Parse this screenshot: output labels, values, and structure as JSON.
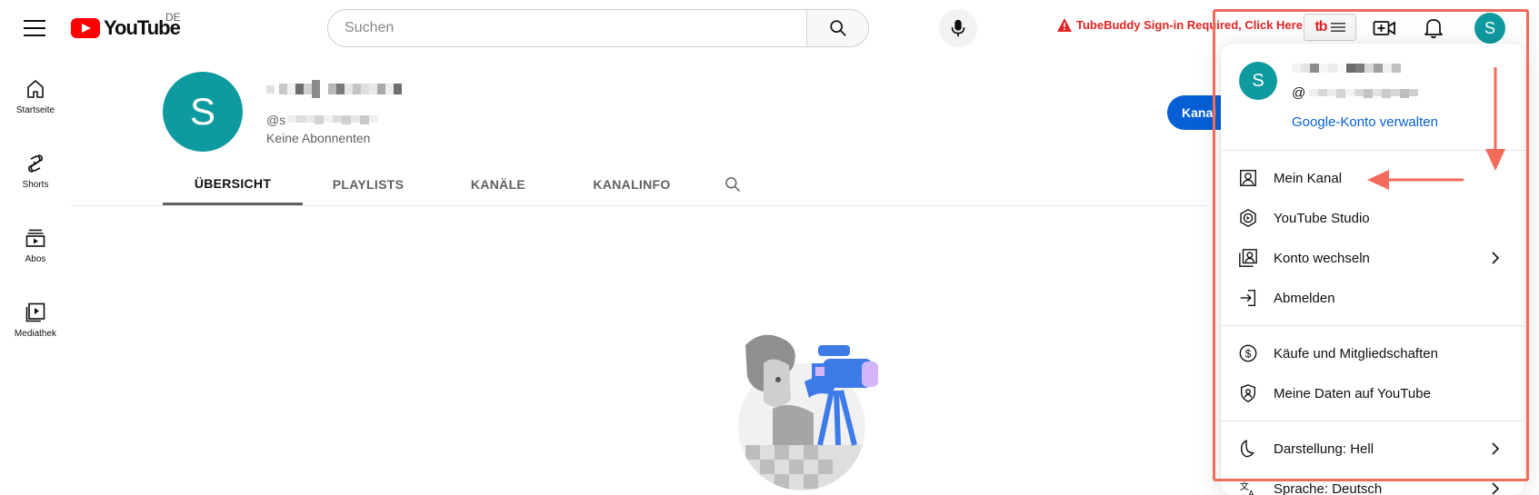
{
  "header": {
    "logo_text": "YouTube",
    "country": "DE",
    "search_placeholder": "Suchen",
    "tubebuddy_warning": "TubeBuddy Sign-in Required, Click Here",
    "tubebuddy_logo": "tb",
    "avatar_letter": "S"
  },
  "sidebar": {
    "items": [
      {
        "label": "Startseite",
        "icon": "home-icon"
      },
      {
        "label": "Shorts",
        "icon": "shorts-icon"
      },
      {
        "label": "Abos",
        "icon": "subscriptions-icon"
      },
      {
        "label": "Mediathek",
        "icon": "library-icon"
      }
    ]
  },
  "channel": {
    "avatar_letter": "S",
    "handle_prefix": "@s",
    "subscribers": "Keine Abonnenten",
    "action_button": "Kanal"
  },
  "tabs": [
    {
      "label": "ÜBERSICHT",
      "active": true
    },
    {
      "label": "PLAYLISTS",
      "active": false
    },
    {
      "label": "KANÄLE",
      "active": false
    },
    {
      "label": "KANALINFO",
      "active": false
    }
  ],
  "menu": {
    "avatar_letter": "S",
    "handle_prefix": "@",
    "manage_account": "Google-Konto verwalten",
    "section1": [
      {
        "label": "Mein Kanal",
        "icon": "channel-icon"
      },
      {
        "label": "YouTube Studio",
        "icon": "studio-icon"
      },
      {
        "label": "Konto wechseln",
        "icon": "switch-account-icon",
        "chevron": true
      },
      {
        "label": "Abmelden",
        "icon": "sign-out-icon"
      }
    ],
    "section2": [
      {
        "label": "Käufe und Mitgliedschaften",
        "icon": "purchases-icon"
      },
      {
        "label": "Meine Daten auf YouTube",
        "icon": "your-data-icon"
      }
    ],
    "section3": [
      {
        "label": "Darstellung: Hell",
        "icon": "moon-icon",
        "chevron": true
      },
      {
        "label": "Sprache: Deutsch",
        "icon": "language-icon",
        "chevron": true
      }
    ]
  },
  "colors": {
    "youtube_red": "#ff0000",
    "avatar_teal": "#0f9a9f",
    "link_blue": "#065fd4",
    "annotation_red": "#f26b5b",
    "warning_red": "#e02424"
  }
}
